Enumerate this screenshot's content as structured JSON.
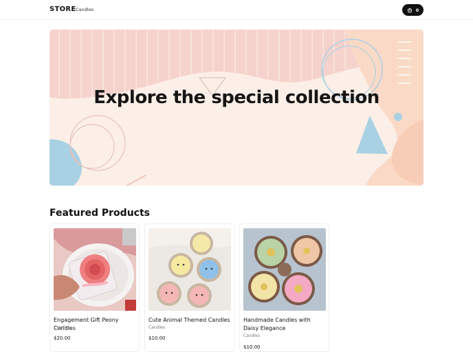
{
  "header": {
    "brand": "STORE",
    "nav": [
      {
        "label": "Candles"
      }
    ],
    "cart_count": "0",
    "cart_icon": "shopping-bag-icon"
  },
  "hero": {
    "title": "Explore the special collection",
    "colors": {
      "background": "#fcefe7",
      "stripes": "#f6d2cc",
      "blue_accent": "#a8d2e3",
      "peach": "#fad9c6"
    }
  },
  "featured": {
    "title": "Featured Products",
    "products": [
      {
        "name": "Engagement Gift Peony Candles",
        "category": "Candles",
        "price": "$20.00"
      },
      {
        "name": "Cute Animal Themed Candles",
        "category": "Candles",
        "price": "$10.00"
      },
      {
        "name": "Handmade Candles with Daisy Elegance",
        "category": "Candles",
        "price": "$10.00"
      }
    ]
  }
}
